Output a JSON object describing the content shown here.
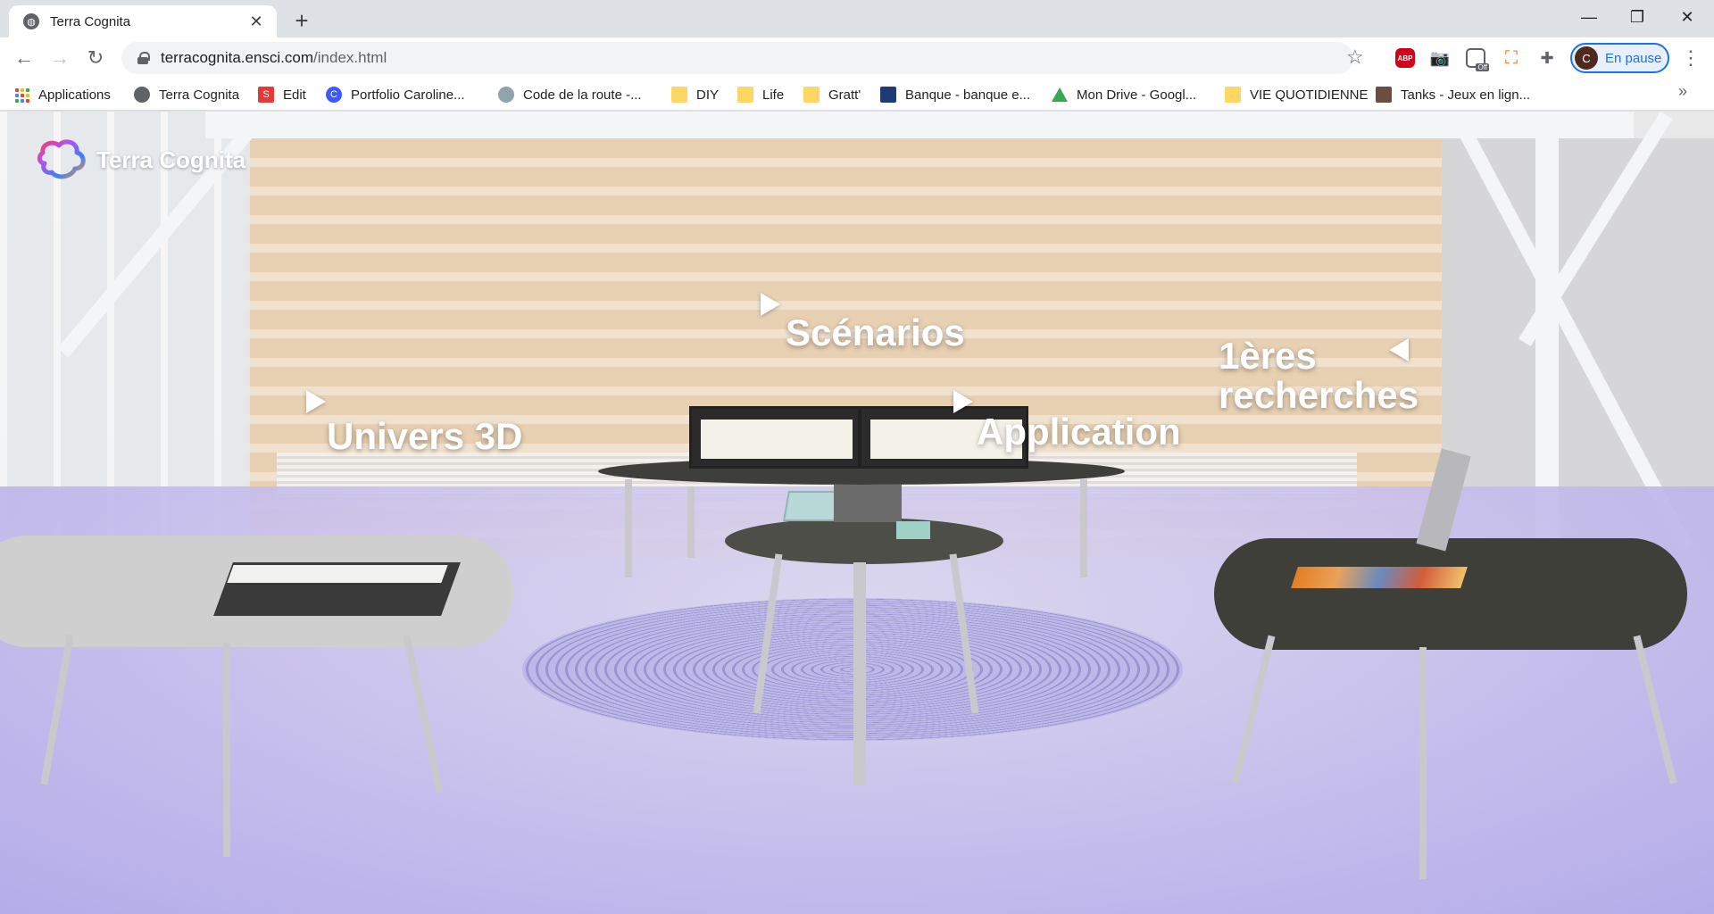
{
  "browser": {
    "tab": {
      "title": "Terra Cognita"
    },
    "url": {
      "host": "terracognita.ensci.com",
      "path": "/index.html"
    },
    "profile": {
      "initial": "C",
      "label": "En pause"
    },
    "extensions": {
      "abp_label": "ABP",
      "off_badge": "Off"
    }
  },
  "bookmarks": [
    {
      "label": "Applications",
      "icon": "apps-grid-icon"
    },
    {
      "label": "Terra Cognita",
      "icon": "globe-icon"
    },
    {
      "label": "Edit",
      "icon": "s-icon"
    },
    {
      "label": "Portfolio Caroline...",
      "icon": "c-icon"
    },
    {
      "label": "Code de la route -...",
      "icon": "car-icon"
    },
    {
      "label": "DIY",
      "icon": "folder-icon"
    },
    {
      "label": "Life",
      "icon": "folder-icon"
    },
    {
      "label": "Gratt'",
      "icon": "folder-icon"
    },
    {
      "label": "Banque - banque e...",
      "icon": "bank-icon"
    },
    {
      "label": "Mon Drive - Googl...",
      "icon": "drive-icon"
    },
    {
      "label": "VIE QUOTIDIENNE",
      "icon": "folder-icon"
    },
    {
      "label": "Tanks - Jeux en lign...",
      "icon": "tanks-icon"
    }
  ],
  "page": {
    "logo_title": "Terra Cognita",
    "hotspots": {
      "scenarios": "Scénarios",
      "univers3d": "Univers 3D",
      "application": "Application",
      "recherches_line1": "1ères",
      "recherches_line2": "recherches"
    }
  },
  "colors": {
    "accent": "#1a73e8",
    "floor": "#bfb8ee",
    "label": "#ffffff"
  }
}
